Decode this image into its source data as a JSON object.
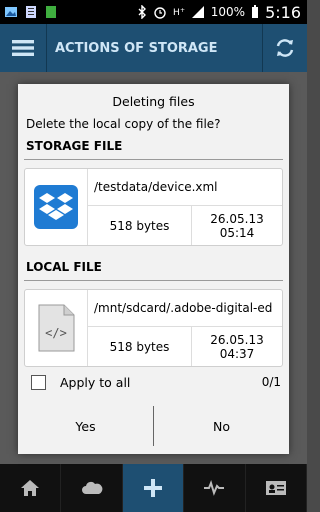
{
  "status_bar": {
    "battery": "100%",
    "time": "5:16"
  },
  "action_bar": {
    "title": "ACTIONS OF STORAGE"
  },
  "dialog": {
    "title": "Deleting files",
    "message": "Delete the local copy of the file?",
    "storage": {
      "section_title": "STORAGE FILE",
      "path": "/testdata/device.xml",
      "size": "518 bytes",
      "date": "26.05.13",
      "time": "05:14"
    },
    "local": {
      "section_title": "LOCAL FILE",
      "path": "/mnt/sdcard/.adobe-digital-ed",
      "size": "518 bytes",
      "date": "26.05.13",
      "time": "04:37"
    },
    "apply_label": "Apply to all",
    "counter": "0/1",
    "yes_label": "Yes",
    "no_label": "No"
  },
  "colors": {
    "accent": "#1e4f72",
    "dropbox": "#1f7bd3"
  }
}
